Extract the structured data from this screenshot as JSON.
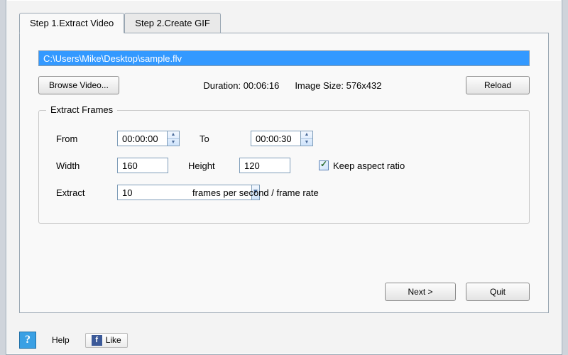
{
  "tabs": {
    "step1": "Step 1.Extract Video",
    "step2": "Step 2.Create GIF"
  },
  "video": {
    "path": "C:\\Users\\Mike\\Desktop\\sample.flv",
    "browse_label": "Browse Video...",
    "duration_label": "Duration:",
    "duration_value": "00:06:16",
    "size_label": "Image Size:",
    "size_value": "576x432",
    "reload_label": "Reload"
  },
  "extract": {
    "legend": "Extract Frames",
    "from_label": "From",
    "from_value": "00:00:00",
    "to_label": "To",
    "to_value": "00:00:30",
    "width_label": "Width",
    "width_value": "160",
    "height_label": "Height",
    "height_value": "120",
    "keep_aspect_label": "Keep aspect ratio",
    "extract_label": "Extract",
    "fps_value": "10",
    "fps_label": "frames per second / frame rate"
  },
  "nav": {
    "next_label": "Next >",
    "quit_label": "Quit"
  },
  "footer": {
    "help_label": "Help",
    "like_label": "Like"
  }
}
